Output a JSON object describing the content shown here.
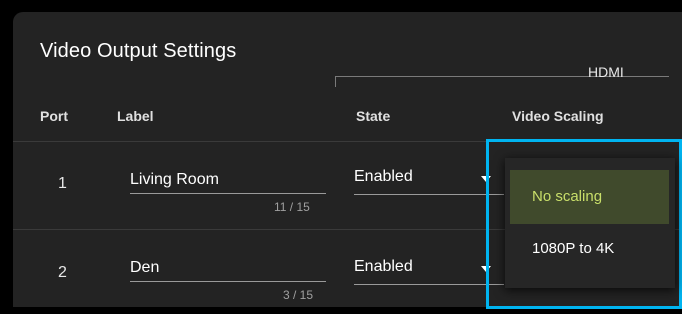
{
  "panel": {
    "title": "Video Output Settings",
    "group_header": "HDMI"
  },
  "columns": {
    "port": "Port",
    "label": "Label",
    "state": "State",
    "video_scaling": "Video Scaling"
  },
  "rows": [
    {
      "port": "1",
      "label": "Living Room",
      "counter": "11 / 15",
      "state": "Enabled"
    },
    {
      "port": "2",
      "label": "Den",
      "counter": "3 / 15",
      "state": "Enabled"
    }
  ],
  "scaling_dropdown": {
    "options": [
      "No scaling",
      "1080P to 4K"
    ],
    "selected": "No scaling"
  },
  "colors": {
    "highlight_border": "#00b4f0",
    "selected_item_bg": "#404a2c",
    "selected_item_text": "#c9df6a",
    "panel_bg": "#232323"
  }
}
